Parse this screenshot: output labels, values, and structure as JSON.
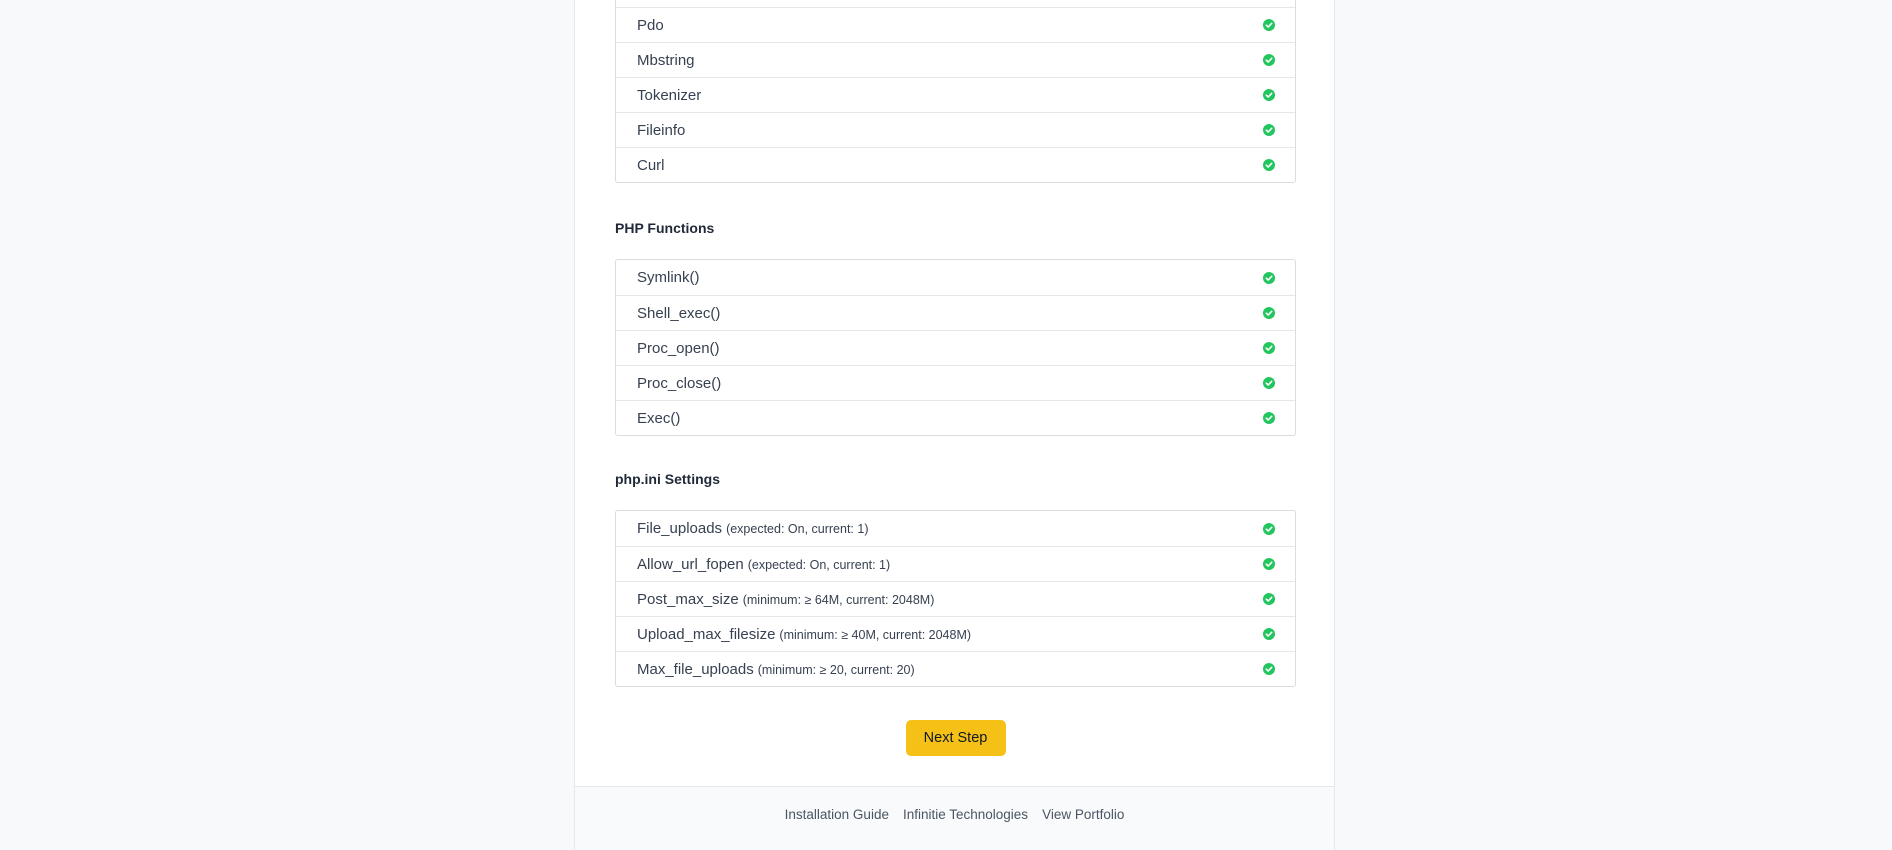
{
  "extensions": {
    "items": [
      {
        "label": ""
      },
      {
        "label": "Pdo"
      },
      {
        "label": "Mbstring"
      },
      {
        "label": "Tokenizer"
      },
      {
        "label": "Fileinfo"
      },
      {
        "label": "Curl"
      }
    ]
  },
  "functions": {
    "title": "PHP Functions",
    "items": [
      {
        "label": "Symlink()"
      },
      {
        "label": "Shell_exec()"
      },
      {
        "label": "Proc_open()"
      },
      {
        "label": "Proc_close()"
      },
      {
        "label": "Exec()"
      }
    ]
  },
  "ini": {
    "title": "php.ini Settings",
    "items": [
      {
        "label": "File_uploads",
        "detail": "(expected: On, current: 1)"
      },
      {
        "label": "Allow_url_fopen",
        "detail": "(expected: On, current: 1)"
      },
      {
        "label": "Post_max_size",
        "detail": "(minimum: ≥ 64M, current: 2048M)"
      },
      {
        "label": "Upload_max_filesize",
        "detail": "(minimum: ≥ 40M, current: 2048M)"
      },
      {
        "label": "Max_file_uploads",
        "detail": "(minimum: ≥ 20, current: 20)"
      }
    ]
  },
  "next_button": {
    "label": "Next Step"
  },
  "footer": {
    "links": [
      {
        "label": "Installation Guide"
      },
      {
        "label": "Infinitie Technologies"
      },
      {
        "label": "View Portfolio"
      }
    ]
  },
  "colors": {
    "check": "#22c55e",
    "button": "#f5c116",
    "background": "#f8f9fb"
  },
  "icons": {
    "status": "check-circle-icon"
  }
}
